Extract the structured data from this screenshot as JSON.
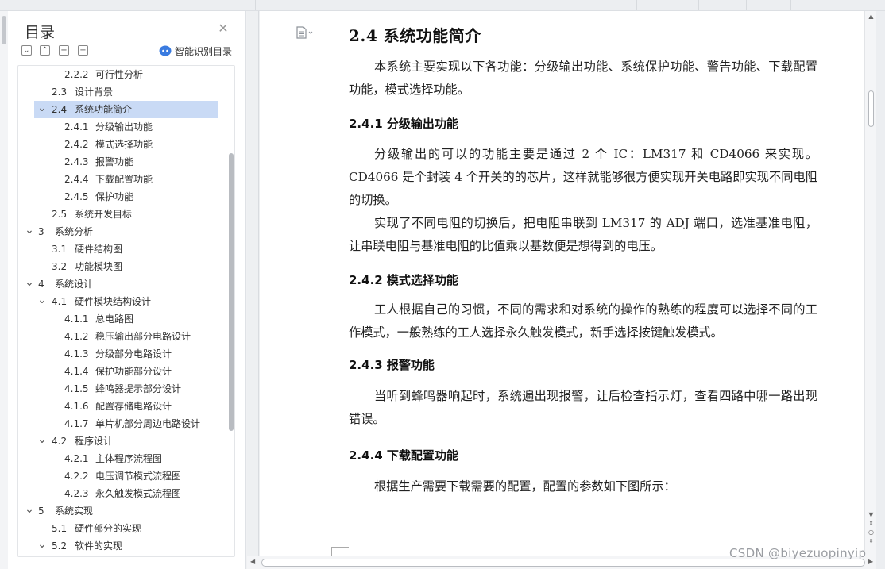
{
  "toc": {
    "title": "目录",
    "close_icon": "close-icon",
    "smart_toc_label": "智能识别目录",
    "items": [
      {
        "level": 3,
        "num": "2.2.2",
        "text": "可行性分析",
        "chev": ""
      },
      {
        "level": 2,
        "num": "2.3",
        "text": "设计背景",
        "chev": ""
      },
      {
        "level": 2,
        "num": "2.4",
        "text": "系统功能简介",
        "chev": "v",
        "selected": true
      },
      {
        "level": 3,
        "num": "2.4.1",
        "text": "分级输出功能",
        "chev": ""
      },
      {
        "level": 3,
        "num": "2.4.2",
        "text": "模式选择功能",
        "chev": ""
      },
      {
        "level": 3,
        "num": "2.4.3",
        "text": "报警功能",
        "chev": ""
      },
      {
        "level": 3,
        "num": "2.4.4",
        "text": "下载配置功能",
        "chev": ""
      },
      {
        "level": 3,
        "num": "2.4.5",
        "text": "保护功能",
        "chev": ""
      },
      {
        "level": 2,
        "num": "2.5",
        "text": "系统开发目标",
        "chev": ""
      },
      {
        "level": 1,
        "num": "3",
        "text": "系统分析",
        "chev": "v"
      },
      {
        "level": 2,
        "num": "3.1",
        "text": "硬件结构图",
        "chev": ""
      },
      {
        "level": 2,
        "num": "3.2",
        "text": "功能模块图",
        "chev": ""
      },
      {
        "level": 1,
        "num": "4",
        "text": "系统设计",
        "chev": "v"
      },
      {
        "level": 2,
        "num": "4.1",
        "text": "硬件模块结构设计",
        "chev": "v"
      },
      {
        "level": 3,
        "num": "4.1.1",
        "text": "总电路图",
        "chev": ""
      },
      {
        "level": 3,
        "num": "4.1.2",
        "text": "稳压输出部分电路设计",
        "chev": ""
      },
      {
        "level": 3,
        "num": "4.1.3",
        "text": "分级部分电路设计",
        "chev": ""
      },
      {
        "level": 3,
        "num": "4.1.4",
        "text": "保护功能部分设计",
        "chev": ""
      },
      {
        "level": 3,
        "num": "4.1.5",
        "text": "蜂鸣器提示部分设计",
        "chev": ""
      },
      {
        "level": 3,
        "num": "4.1.6",
        "text": "配置存储电路设计",
        "chev": ""
      },
      {
        "level": 3,
        "num": "4.1.7",
        "text": "单片机部分周边电路设计",
        "chev": ""
      },
      {
        "level": 2,
        "num": "4.2",
        "text": "程序设计",
        "chev": "v"
      },
      {
        "level": 3,
        "num": "4.2.1",
        "text": "主体程序流程图",
        "chev": ""
      },
      {
        "level": 3,
        "num": "4.2.2",
        "text": "电压调节模式流程图",
        "chev": ""
      },
      {
        "level": 3,
        "num": "4.2.3",
        "text": "永久触发模式流程图",
        "chev": ""
      },
      {
        "level": 1,
        "num": "5",
        "text": "系统实现",
        "chev": "v"
      },
      {
        "level": 2,
        "num": "5.1",
        "text": "硬件部分的实现",
        "chev": ""
      },
      {
        "level": 2,
        "num": "5.2",
        "text": "软件的实现",
        "chev": "v"
      }
    ]
  },
  "document": {
    "heading": "2.4   系统功能简介",
    "intro": "本系统主要实现以下各功能：分级输出功能、系统保护功能、警告功能、下载配置功能，模式选择功能。",
    "s1_title": "2.4.1   分级输出功能",
    "s1_p1": "分级输出的可以的功能主要是通过 2 个 IC：LM317 和 CD4066 来实现。CD4066 是个封装 4 个开关的的芯片，这样就能够很方便实现开关电路即实现不同电阻的切换。",
    "s1_p2": "实现了不同电阻的切换后，把电阻串联到 LM317 的 ADJ 端口，选准基准电阻，让串联电阻与基准电阻的比值乘以基数便是想得到的电压。",
    "s2_title": "2.4.2   模式选择功能",
    "s2_p1": "工人根据自己的习惯，不同的需求和对系统的操作的熟练的程度可以选择不同的工作模式，一般熟练的工人选择永久触发模式，新手选择按键触发模式。",
    "s3_title": "2.4.3   报警功能",
    "s3_p1": "当听到蜂鸣器响起时，系统遍出现报警，让后检查指示灯，查看四路中哪一路出现错误。",
    "s4_title": "2.4.4   下载配置功能",
    "s4_p1": "根据生产需要下载需要的配置，配置的参数如下图所示："
  },
  "watermark": "CSDN @biyezuopinyip"
}
